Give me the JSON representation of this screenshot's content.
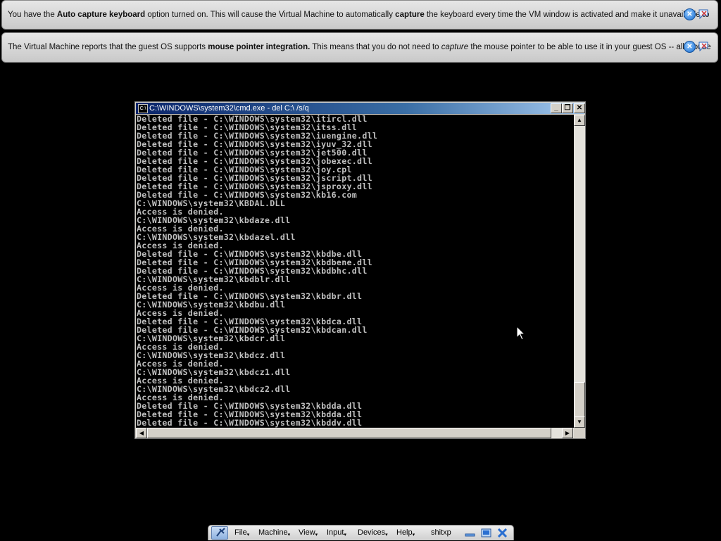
{
  "notifications": [
    {
      "segments": [
        {
          "t": "You have the ",
          "b": false
        },
        {
          "t": "Auto capture keyboard",
          "b": true
        },
        {
          "t": " option turned on. This will cause the Virtual Machine to automatically ",
          "b": false
        },
        {
          "t": "capture",
          "b": true
        },
        {
          "t": " the keyboard every time the VM window is activated and make it unavailable to",
          "b": false
        }
      ]
    },
    {
      "segments": [
        {
          "t": "The Virtual Machine reports that the guest OS supports ",
          "b": false
        },
        {
          "t": "mouse pointer integration.",
          "b": true
        },
        {
          "t": " This means that you do not need to ",
          "b": false
        },
        {
          "t": "capture",
          "b": false,
          "i": true
        },
        {
          "t": " the mouse pointer to be able to use it in your guest OS -- all mouse",
          "b": false
        }
      ]
    }
  ],
  "cmd_window": {
    "title": "C:\\WINDOWS\\system32\\cmd.exe - del C:\\ /s/q",
    "icon_text": "C:\\",
    "lines": [
      "Deleted file - C:\\WINDOWS\\system32\\itircl.dll",
      "Deleted file - C:\\WINDOWS\\system32\\itss.dll",
      "Deleted file - C:\\WINDOWS\\system32\\iuengine.dll",
      "Deleted file - C:\\WINDOWS\\system32\\iyuv_32.dll",
      "Deleted file - C:\\WINDOWS\\system32\\jet500.dll",
      "Deleted file - C:\\WINDOWS\\system32\\jobexec.dll",
      "Deleted file - C:\\WINDOWS\\system32\\joy.cpl",
      "Deleted file - C:\\WINDOWS\\system32\\jscript.dll",
      "Deleted file - C:\\WINDOWS\\system32\\jsproxy.dll",
      "Deleted file - C:\\WINDOWS\\system32\\kb16.com",
      "C:\\WINDOWS\\system32\\KBDAL.DLL",
      "Access is denied.",
      "C:\\WINDOWS\\system32\\kbdaze.dll",
      "Access is denied.",
      "C:\\WINDOWS\\system32\\kbdazel.dll",
      "Access is denied.",
      "Deleted file - C:\\WINDOWS\\system32\\kbdbe.dll",
      "Deleted file - C:\\WINDOWS\\system32\\kbdbene.dll",
      "Deleted file - C:\\WINDOWS\\system32\\kbdbhc.dll",
      "C:\\WINDOWS\\system32\\kbdblr.dll",
      "Access is denied.",
      "Deleted file - C:\\WINDOWS\\system32\\kbdbr.dll",
      "C:\\WINDOWS\\system32\\kbdbu.dll",
      "Access is denied.",
      "Deleted file - C:\\WINDOWS\\system32\\kbdca.dll",
      "Deleted file - C:\\WINDOWS\\system32\\kbdcan.dll",
      "C:\\WINDOWS\\system32\\kbdcr.dll",
      "Access is denied.",
      "C:\\WINDOWS\\system32\\kbdcz.dll",
      "Access is denied.",
      "C:\\WINDOWS\\system32\\kbdcz1.dll",
      "Access is denied.",
      "C:\\WINDOWS\\system32\\kbdcz2.dll",
      "Access is denied.",
      "Deleted file - C:\\WINDOWS\\system32\\kbdda.dll",
      "Deleted file - C:\\WINDOWS\\system32\\kbdda.dll",
      "Deleted file - C:\\WINDOWS\\system32\\kbddv.dll"
    ],
    "buttons": {
      "minimize": "_",
      "restore": "❐",
      "close": "✕"
    }
  },
  "vbox_toolbar": {
    "menus": [
      "File",
      "Machine",
      "View",
      "Input",
      "Devices",
      "Help"
    ],
    "vm_name": "shitxp"
  }
}
